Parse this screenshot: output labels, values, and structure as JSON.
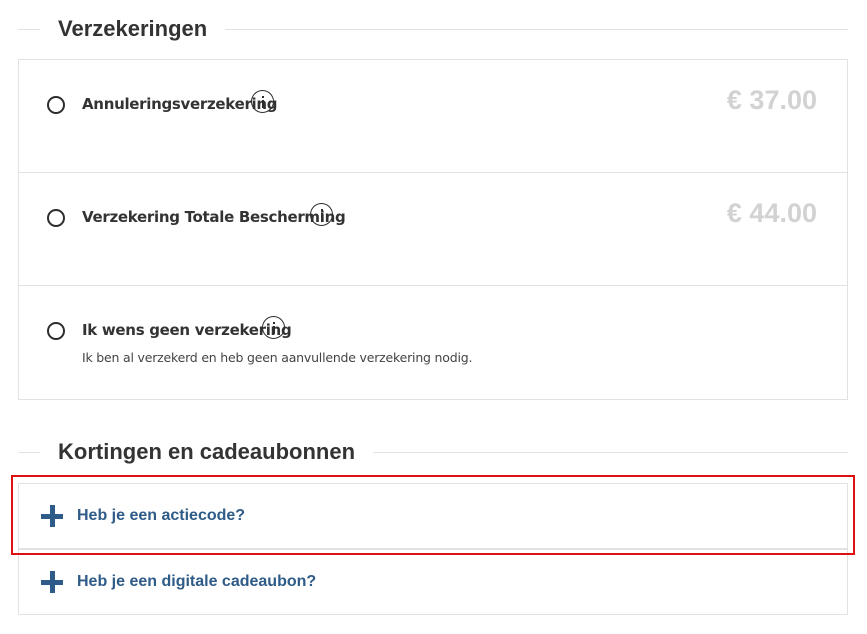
{
  "insurance": {
    "title": "Verzekeringen",
    "options": [
      {
        "label": "Annuleringsverzekering",
        "price": "€ 37.00"
      },
      {
        "label": "Verzekering Totale Bescherming",
        "price": "€ 44.00"
      },
      {
        "label": "Ik wens geen verzekering",
        "description": "Ik ben al verzekerd en heb geen aanvullende verzekering nodig."
      }
    ]
  },
  "discounts": {
    "title": "Kortingen en cadeaubonnen",
    "items": [
      {
        "label": "Heb je een actiecode?"
      },
      {
        "label": "Heb je een digitale cadeaubon?"
      }
    ]
  },
  "colors": {
    "accent": "#2e5b87",
    "price_disabled": "#d2d2d2",
    "highlight": "#dd1111",
    "border": "#e2e2e2"
  },
  "icons": {
    "info": "info-icon",
    "plus": "plus-icon"
  }
}
